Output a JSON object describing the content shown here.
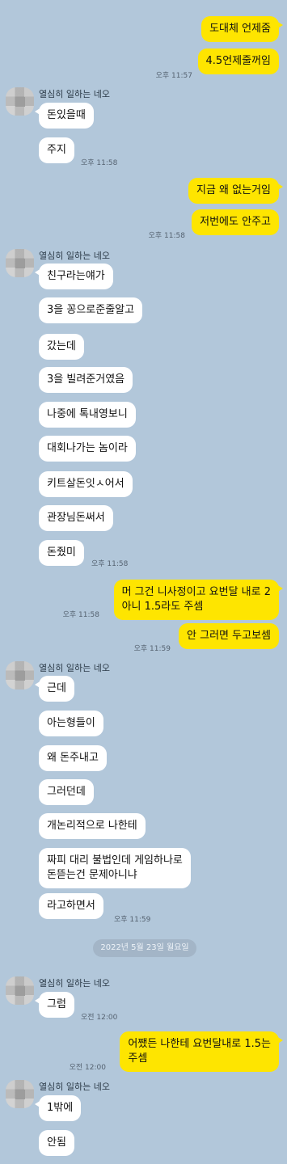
{
  "sender_name": "열심히 일하는 네오",
  "date_divider": "2022년 5월 23일 월요일",
  "messages": [
    {
      "text": "도대체 언제줌"
    },
    {
      "text": "4.5언제줄꺼임",
      "time": "오후 11:57"
    },
    {
      "text": "돈있을때"
    },
    {
      "text": "주지",
      "time": "오후 11:58"
    },
    {
      "text": "지금 왜 없는거임"
    },
    {
      "text": "저번에도 안주고",
      "time": "오후 11:58"
    },
    {
      "text": "친구라는얘가"
    },
    {
      "text": "3을 꽁으로준줄알고"
    },
    {
      "text": "갔는데"
    },
    {
      "text": "3을 빌려준거였음"
    },
    {
      "text": "나중에 톡내영보니"
    },
    {
      "text": "대회나가는 놈이라"
    },
    {
      "text": "키트살돈잇ㅅ어서"
    },
    {
      "text": "관장님돈써서"
    },
    {
      "text": "돈줬미",
      "time": "오후 11:58"
    },
    {
      "text": "머 그건 니사정이고 요번달 내로 2\n아니 1.5라도 주셈",
      "time": "오후 11:58"
    },
    {
      "text": "안 그러면 두고보셈",
      "time": "오후 11:59"
    },
    {
      "text": "근데"
    },
    {
      "text": "아는형들이"
    },
    {
      "text": "왜 돈주내고"
    },
    {
      "text": "그러던데"
    },
    {
      "text": "개논리적으로 나한테"
    },
    {
      "text": "짜피 대리 불법인데 게임하나로\n돈뜯는건 문제아니냐"
    },
    {
      "text": "라고하면서",
      "time": "오후 11:59"
    },
    {
      "text": "그럼",
      "time": "오전 12:00"
    },
    {
      "text": "어쨌든 나한테 요번달내로 1.5는\n주셈",
      "time": "오전 12:00"
    },
    {
      "text": "1밖에"
    },
    {
      "text": "안됨"
    }
  ]
}
